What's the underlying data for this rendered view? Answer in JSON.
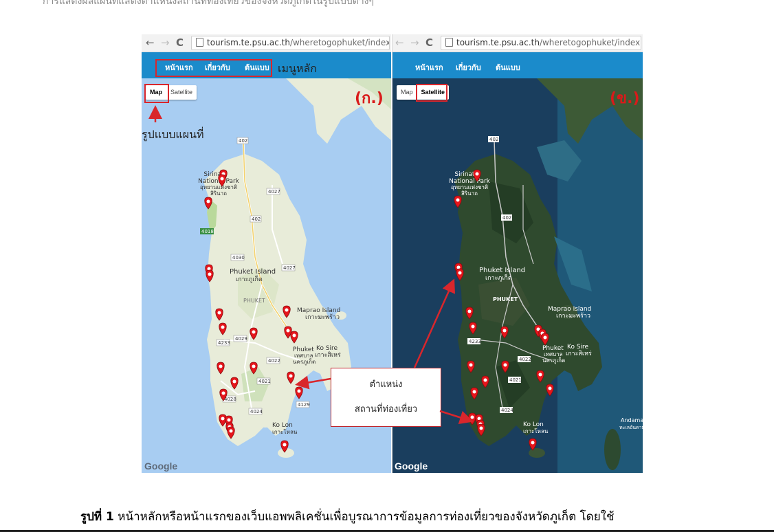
{
  "top_text": "การแสดงผลแผนที่แสดงตำแหน่งสถานที่ท่องเที่ยวของจังหวัดภูเก็ตในรูปแบบต่างๆ",
  "browser": {
    "back": "←",
    "forward": "→",
    "reload": "C",
    "url_host": "tourism.te.psu.ac.th",
    "url_path": "/wheretogophuket/index.html"
  },
  "menu": [
    "หน้าแรก",
    "เกี่ยวกับ",
    "ต้นแบบ"
  ],
  "map_types": {
    "map": "Map",
    "satellite": "Satellite"
  },
  "panel_labels": {
    "a": "(ก.)",
    "b": "(ข.)"
  },
  "annotations": {
    "main_menu": "เมนูหลัก",
    "map_format": "รูปแบบแผนที่",
    "callout_line1": "ตำแหน่ง",
    "callout_line2": "สถานที่ท่องเที่ยว"
  },
  "map_labels": {
    "national_park_1": "Sirinat",
    "national_park_2": "National Park",
    "national_park_th": "อุทยานแห่งชาติ",
    "national_park_th2": "สิรินาถ",
    "island": "Phuket Island",
    "island_th": "เกาะภูเก็ต",
    "province": "PHUKET",
    "maprao": "Maprao Island",
    "maprao_th": "เกาะมะพร้าว",
    "kosire": "Ko Sire",
    "kosire_th": "เกาะสิเหร่",
    "town": "Phuket",
    "town_th1": "เทศบาล",
    "town_th2": "นครภูเก็ต",
    "kolon": "Ko Lon",
    "kolon_th": "เกาะโหลน",
    "andaman": "Andaman",
    "andaman_th": "ทะเลอันดามัน",
    "road_402": "402",
    "road_4027": "4027",
    "road_4030": "4030",
    "road_4031": "4031",
    "road_4029": "4029",
    "road_4233": "4233",
    "road_4022": "4022",
    "road_4021": "4021",
    "road_4028": "4028",
    "road_4024": "4024",
    "road_4129": "4129",
    "road_4018": "4018"
  },
  "google": "Google",
  "caption": {
    "label": "รูปที่ 1",
    "text": "หน้าหลักหรือหน้าแรกของเว็บแอพพลิเคชั่นเพื่อบูรณาการข้อมูลการท่องเที่ยวของจังหวัดภูเก็ต โดยใช้"
  },
  "colors": {
    "nav_blue": "#1b8bcb",
    "annotation_red": "#d9262c",
    "map_land": "#e8ecd9",
    "map_water": "#a8cdf2",
    "sat_water": "#1a3e5e",
    "sat_land": "#2f4a2e",
    "marker": "#e5161c"
  }
}
